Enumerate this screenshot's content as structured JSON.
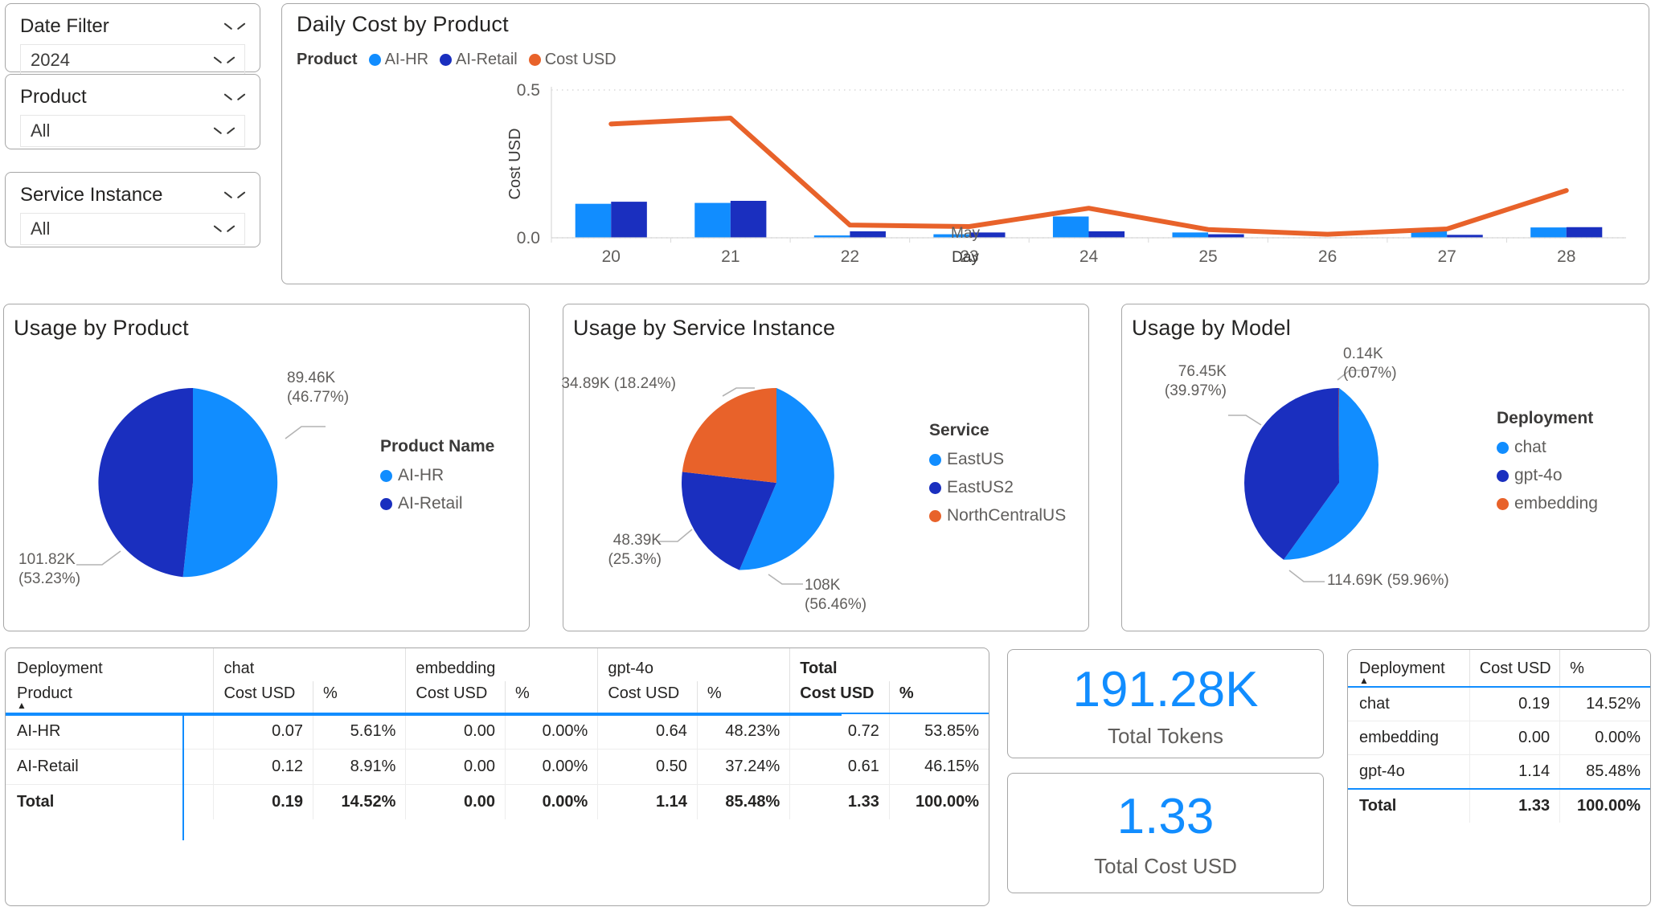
{
  "colors": {
    "ai_hr": "#118dff",
    "ai_retail": "#1a2fbf",
    "cost_line": "#e8622a",
    "accent": "#118dff",
    "text": "#252423",
    "muted": "#605e5c"
  },
  "slicers": [
    {
      "label": "Date Filter",
      "value": "2024",
      "icon": "chevron-down-icon"
    },
    {
      "label": "Product",
      "value": "All",
      "icon": "chevron-down-icon"
    },
    {
      "label": "Service Instance",
      "value": "All",
      "icon": "chevron-down-icon"
    }
  ],
  "combo": {
    "title": "Daily Cost by Product",
    "legend_title": "Product",
    "legend": [
      {
        "label": "AI-HR",
        "color": "#118dff"
      },
      {
        "label": "AI-Retail",
        "color": "#1a2fbf"
      },
      {
        "label": "Cost USD",
        "color": "#e8622a"
      }
    ]
  },
  "chart_data": [
    {
      "type": "bar",
      "title": "Daily Cost by Product",
      "xlabel": "Day",
      "ylabel": "Cost USD",
      "x_axis_note": "May",
      "categories": [
        "20",
        "21",
        "22",
        "23",
        "24",
        "25",
        "26",
        "27",
        "28"
      ],
      "ylim": [
        0.0,
        0.5
      ],
      "yticks": [
        "0.0",
        "0.5"
      ],
      "grid": true,
      "legend": "top",
      "series": [
        {
          "name": "AI-HR",
          "type": "bar",
          "color": "#118dff",
          "values": [
            0.115,
            0.118,
            0.008,
            0.012,
            0.072,
            0.018,
            0.0,
            0.022,
            0.035
          ]
        },
        {
          "name": "AI-Retail",
          "type": "bar",
          "color": "#1a2fbf",
          "values": [
            0.122,
            0.125,
            0.022,
            0.018,
            0.022,
            0.012,
            0.0,
            0.01,
            0.036
          ]
        },
        {
          "name": "Cost USD",
          "type": "line",
          "color": "#e8622a",
          "values": [
            0.385,
            0.405,
            0.043,
            0.038,
            0.1,
            0.028,
            0.012,
            0.03,
            0.16
          ]
        }
      ]
    },
    {
      "type": "pie",
      "title": "Usage by Product",
      "legend_title": "Product Name",
      "slices": [
        {
          "label": "AI-HR",
          "value": "89.46K",
          "percent": "46.77%",
          "color": "#118dff",
          "pct": 46.77
        },
        {
          "label": "AI-Retail",
          "value": "101.82K",
          "percent": "53.23%",
          "color": "#1a2fbf",
          "pct": 53.23
        }
      ]
    },
    {
      "type": "pie",
      "title": "Usage by Service Instance",
      "legend_title": "Service",
      "slices": [
        {
          "label": "EastUS",
          "value": "108K",
          "percent": "56.46%",
          "color": "#118dff",
          "pct": 56.46
        },
        {
          "label": "EastUS2",
          "value": "48.39K",
          "percent": "25.3%",
          "color": "#1a2fbf",
          "pct": 25.3
        },
        {
          "label": "NorthCentralUS",
          "value": "34.89K",
          "percent": "18.24%",
          "color": "#e8622a",
          "pct": 18.24
        }
      ]
    },
    {
      "type": "pie",
      "title": "Usage by Model",
      "legend_title": "Deployment",
      "slices": [
        {
          "label": "chat",
          "value": "114.69K",
          "percent": "59.96%",
          "color": "#118dff",
          "pct": 59.96
        },
        {
          "label": "gpt-4o",
          "value": "76.45K",
          "percent": "39.97%",
          "color": "#1a2fbf",
          "pct": 39.97
        },
        {
          "label": "embedding",
          "value": "0.14K",
          "percent": "0.07%",
          "color": "#e8622a",
          "pct": 0.07
        }
      ]
    }
  ],
  "pies": {
    "product": {
      "title": "Usage by Product",
      "legend_title": "Product Name",
      "callout_top": {
        "value": "89.46K",
        "percent": "(46.77%)"
      },
      "callout_bottom": {
        "value": "101.82K",
        "percent": "(53.23%)"
      }
    },
    "service": {
      "title": "Usage by Service Instance",
      "legend_title": "Service",
      "callout_top": "34.89K (18.24%)",
      "callout_left": {
        "value": "48.39K",
        "percent": "(25.3%)"
      },
      "callout_bottom": {
        "value": "108K",
        "percent": "(56.46%)"
      }
    },
    "model": {
      "title": "Usage by Model",
      "legend_title": "Deployment",
      "callout_small": {
        "value": "0.14K",
        "percent": "(0.07%)"
      },
      "callout_left": {
        "value": "76.45K",
        "percent": "(39.97%)"
      },
      "callout_bottom": "114.69K (59.96%)"
    }
  },
  "matrix": {
    "corner_top": "Deployment",
    "corner_bottom": "Product",
    "sort_caret": "▲",
    "groups": [
      {
        "label": "chat",
        "bold": false
      },
      {
        "label": "embedding",
        "bold": false
      },
      {
        "label": "gpt-4o",
        "bold": false
      },
      {
        "label": "Total",
        "bold": true
      }
    ],
    "subheaders": [
      {
        "a": "Cost USD",
        "b": "%",
        "bold": false
      },
      {
        "a": "Cost USD",
        "b": "%",
        "bold": false
      },
      {
        "a": "Cost USD",
        "b": "%",
        "bold": false
      },
      {
        "a": "Cost USD",
        "b": "%",
        "bold": true
      }
    ],
    "rows": [
      {
        "name": "AI-HR",
        "bold": false,
        "cells": [
          "0.07",
          "5.61%",
          "0.00",
          "0.00%",
          "0.64",
          "48.23%",
          "0.72",
          "53.85%"
        ]
      },
      {
        "name": "AI-Retail",
        "bold": false,
        "cells": [
          "0.12",
          "8.91%",
          "0.00",
          "0.00%",
          "0.50",
          "37.24%",
          "0.61",
          "46.15%"
        ]
      },
      {
        "name": "Total",
        "bold": true,
        "cells": [
          "0.19",
          "14.52%",
          "0.00",
          "0.00%",
          "1.14",
          "85.48%",
          "1.33",
          "100.00%"
        ]
      }
    ]
  },
  "kpis": [
    {
      "value": "191.28K",
      "label": "Total Tokens"
    },
    {
      "value": "1.33",
      "label": "Total Cost USD"
    }
  ],
  "deployment_table": {
    "headers": [
      "Deployment",
      "Cost USD",
      "%"
    ],
    "sort_caret": "▲",
    "rows": [
      {
        "name": "chat",
        "cost": "0.19",
        "pct": "14.52%",
        "bold": false
      },
      {
        "name": "embedding",
        "cost": "0.00",
        "pct": "0.00%",
        "bold": false
      },
      {
        "name": "gpt-4o",
        "cost": "1.14",
        "pct": "85.48%",
        "bold": false
      },
      {
        "name": "Total",
        "cost": "1.33",
        "pct": "100.00%",
        "bold": true
      }
    ]
  }
}
